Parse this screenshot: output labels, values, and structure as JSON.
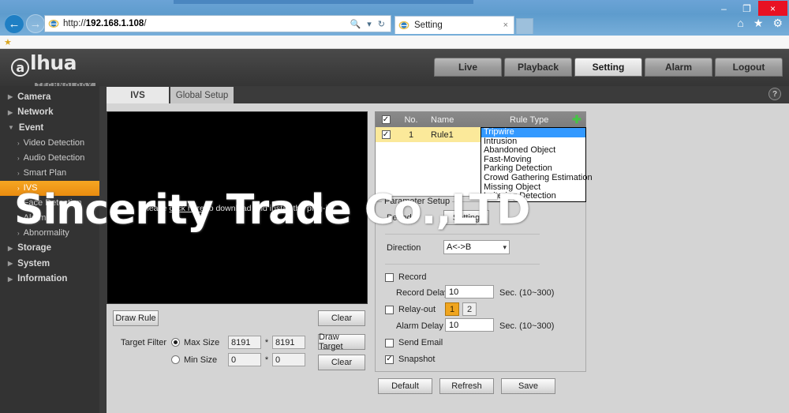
{
  "browser": {
    "window_controls": {
      "minimize": "–",
      "maximize": "❐",
      "close": "×"
    },
    "nav": {
      "back": "←",
      "forward": "→"
    },
    "address": {
      "protocol": "http://",
      "host": "192.168.1.108",
      "path": "/",
      "search_icon": "🔍",
      "dropdown_caret": "▾",
      "refresh_icon": "↻"
    },
    "tab": {
      "title": "Setting",
      "close": "×"
    },
    "toolbar_icons": {
      "home": "⌂",
      "favorites": "★",
      "tools": "⚙"
    },
    "favorites_bar": {
      "add_icon": "★"
    }
  },
  "app": {
    "logo": {
      "mark": "a",
      "word": "lhua",
      "tagline": "TECHNOLOGY"
    },
    "topnav": [
      {
        "label": "Live",
        "active": false
      },
      {
        "label": "Playback",
        "active": false
      },
      {
        "label": "Setting",
        "active": true
      },
      {
        "label": "Alarm",
        "active": false
      },
      {
        "label": "Logout",
        "active": false
      }
    ],
    "help_icon": "?"
  },
  "sidebar": {
    "items": [
      {
        "label": "Camera",
        "arrow": "▶"
      },
      {
        "label": "Network",
        "arrow": "▶"
      },
      {
        "label": "Event",
        "arrow": "▼"
      }
    ],
    "event_children": [
      {
        "label": "Video Detection",
        "arrow": "›",
        "selected": false
      },
      {
        "label": "Audio Detection",
        "arrow": "›",
        "selected": false
      },
      {
        "label": "Smart Plan",
        "arrow": "›",
        "selected": false
      },
      {
        "label": "IVS",
        "arrow": "›",
        "selected": true
      },
      {
        "label": "Face Detection",
        "arrow": "›",
        "selected": false
      },
      {
        "label": "Alarm",
        "arrow": "›",
        "selected": false
      },
      {
        "label": "Abnormality",
        "arrow": "›",
        "selected": false
      }
    ],
    "tail_items": [
      {
        "label": "Storage",
        "arrow": "▶"
      },
      {
        "label": "System",
        "arrow": "▶"
      },
      {
        "label": "Information",
        "arrow": "▶"
      }
    ]
  },
  "tabs": [
    {
      "label": "IVS",
      "active": true
    },
    {
      "label": "Global Setup",
      "active": false
    }
  ],
  "video": {
    "plugin_message_prefix": "Please ",
    "plugin_message_link": "click here",
    "plugin_message_suffix": " to download and install the plug-in."
  },
  "left_controls": {
    "draw_rule_label": "Draw Rule",
    "clear_rule_label": "Clear",
    "target_filter_label": "Target Filter",
    "max_size_label": "Max Size",
    "max_size_selected": true,
    "max_width": "8191",
    "max_height": "8191",
    "min_size_label": "Min Size",
    "min_size_selected": false,
    "min_width": "0",
    "min_height": "0",
    "separator": "*",
    "draw_target_label": "Draw Target",
    "clear_target_label": "Clear"
  },
  "rule_table": {
    "headers": {
      "check": "✓",
      "no": "No.",
      "name": "Name",
      "rule_type": "Rule Type",
      "add": "✚"
    },
    "header_checked": true,
    "rows": [
      {
        "checked": true,
        "check_glyph": "✓",
        "no": "1",
        "name": "Rule1",
        "rule_type": "Tripwire"
      }
    ]
  },
  "rule_type_dropdown": {
    "open": true,
    "options": [
      {
        "label": "Tripwire",
        "selected": true
      },
      {
        "label": "Intrusion",
        "selected": false
      },
      {
        "label": "Abandoned Object",
        "selected": false
      },
      {
        "label": "Fast-Moving",
        "selected": false
      },
      {
        "label": "Parking Detection",
        "selected": false
      },
      {
        "label": "Crowd Gathering Estimation",
        "selected": false
      },
      {
        "label": "Missing Object",
        "selected": false
      },
      {
        "label": "Loitering Detection",
        "selected": false
      }
    ]
  },
  "parameter_setup": {
    "legend": "Parameter Setup",
    "period_label": "Period",
    "period_button": "Setting",
    "direction_label": "Direction",
    "direction_value": "A<->B",
    "direction_caret": "⌄",
    "record_label": "Record",
    "record_checked": false,
    "record_delay_label": "Record Delay",
    "record_delay_value": "10",
    "record_delay_unit": "Sec. (10~300)",
    "relay_out_label": "Relay-out",
    "relay_out_checked": false,
    "relay_buttons": [
      {
        "label": "1",
        "active": true
      },
      {
        "label": "2",
        "active": false
      }
    ],
    "alarm_delay_label": "Alarm Delay",
    "alarm_delay_value": "10",
    "alarm_delay_unit": "Sec. (10~300)",
    "send_email_label": "Send Email",
    "send_email_checked": false,
    "snapshot_label": "Snapshot",
    "snapshot_checked": true,
    "check_glyph": "✓"
  },
  "footer_buttons": [
    {
      "label": "Default"
    },
    {
      "label": "Refresh"
    },
    {
      "label": "Save"
    }
  ],
  "watermark": {
    "text": "Sincerity Trade Co.,LTD"
  },
  "colors": {
    "accent_orange": "#f0a51e",
    "selection_blue": "#3399ff",
    "row_yellow": "#fbe99a",
    "panel_gray": "#d4d4d4",
    "chrome_dark": "#3b3b3b"
  }
}
